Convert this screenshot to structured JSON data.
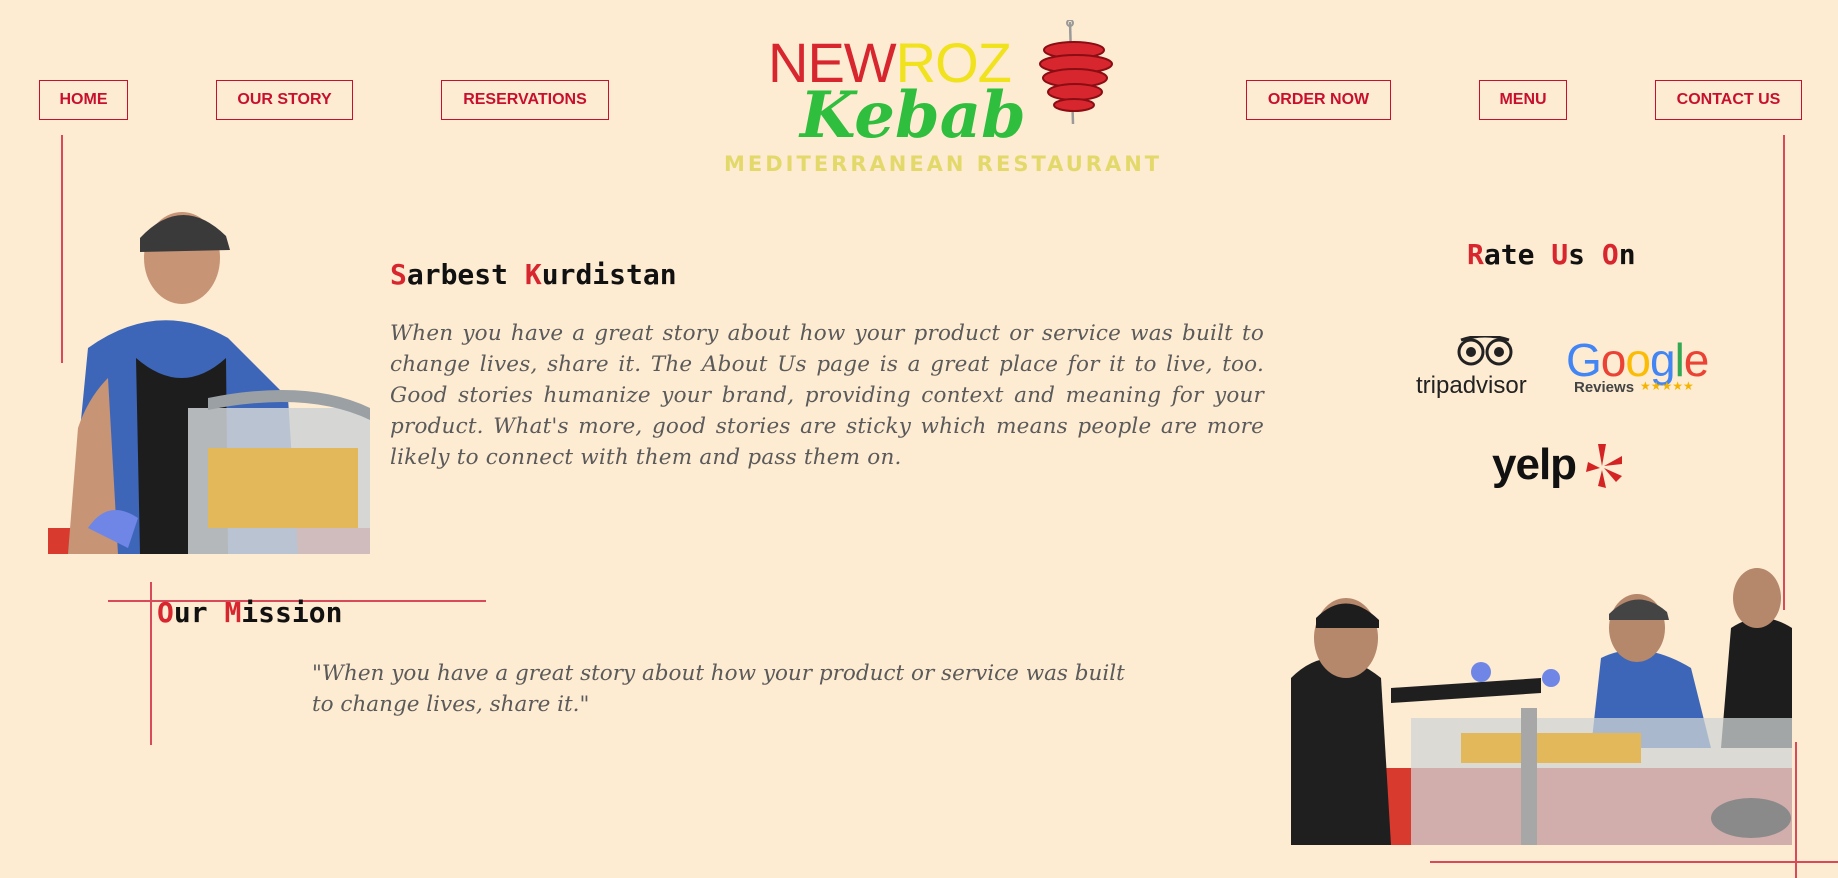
{
  "nav": {
    "home": "HOME",
    "our_story": "OUR STORY",
    "reservations": "RESERVATIONS",
    "order_now": "ORDER NOW",
    "menu": "MENU",
    "contact_us": "CONTACT US"
  },
  "logo": {
    "newroz_part1": "NEW",
    "newroz_part2": "ROZ",
    "kebab": "Kebab",
    "tagline": "MEDITERRANEAN RESTAURANT"
  },
  "about": {
    "name_initial1": "S",
    "name_rest1": "arbest ",
    "name_initial2": "K",
    "name_rest2": "urdistan",
    "body": "When you have a great story about how your product or service was built to change lives, share it. The About Us page is a great place for it to live, too. Good stories humanize your brand, providing context and meaning for your product. What's more, good stories are sticky which means people are more likely to connect with them and pass them on."
  },
  "rate": {
    "initial1": "R",
    "rest1": "ate ",
    "initial2": "U",
    "rest2": "s ",
    "initial3": "O",
    "rest3": "n",
    "tripadvisor": "tripadvisor",
    "google": "Google",
    "google_reviews": "Reviews",
    "yelp": "yelp"
  },
  "mission": {
    "initial1": "O",
    "rest1": "ur ",
    "initial2": "M",
    "rest2": "ission",
    "quote": "\"When you have a great story about how your product or service was built to change lives, share it.\""
  },
  "colors": {
    "background": "#fdebd2",
    "accent_red": "#d7262e",
    "logo_green": "#2fbe3e",
    "logo_yellow": "#f1e21e"
  }
}
